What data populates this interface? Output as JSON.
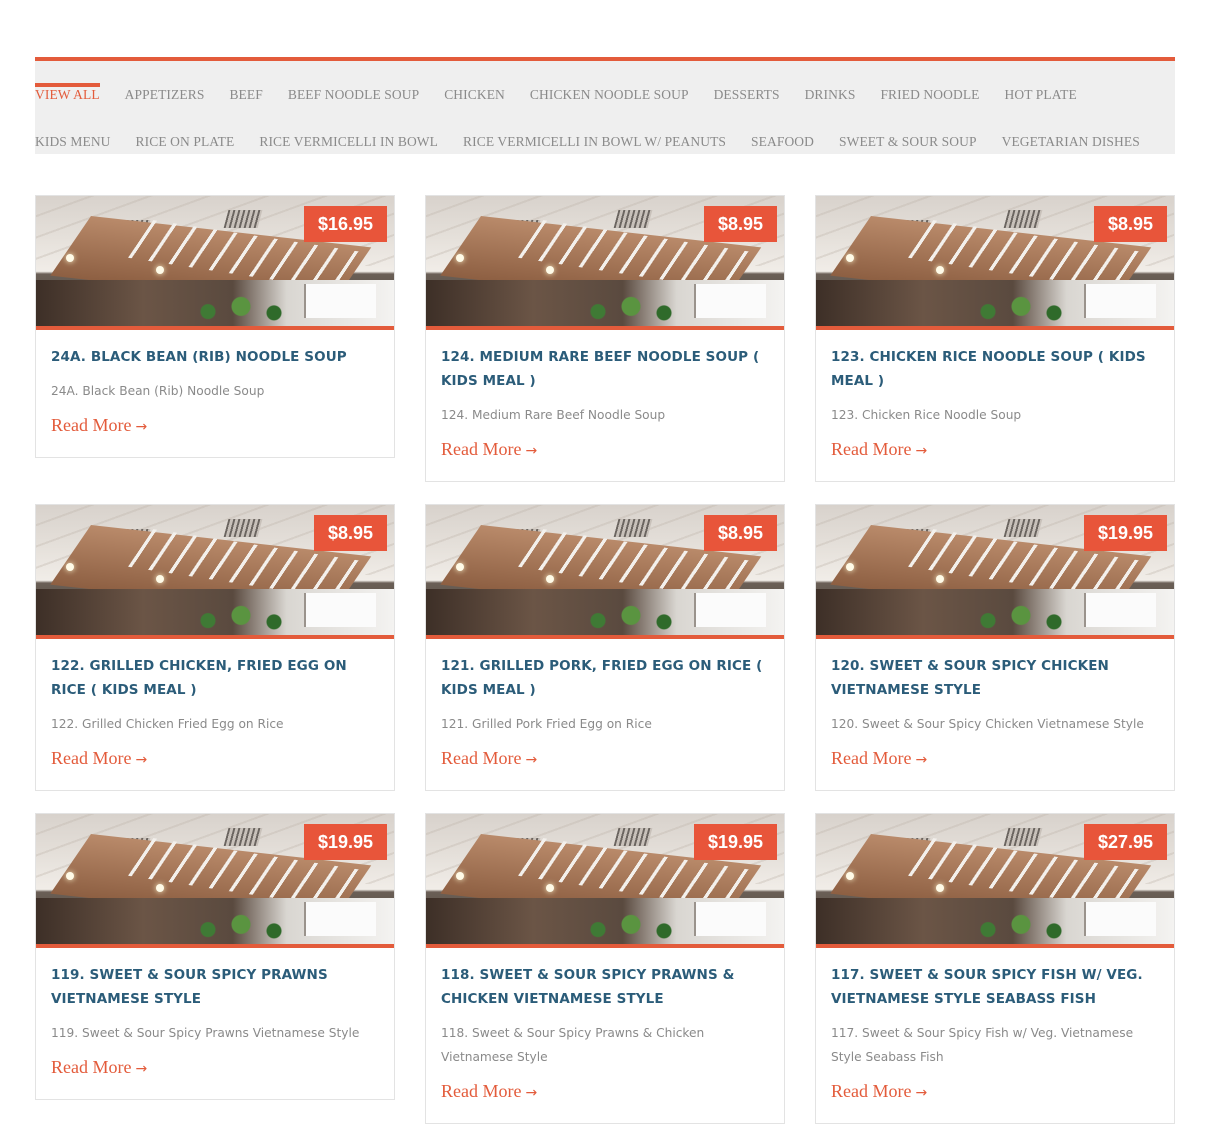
{
  "filters": {
    "row1": [
      "VIEW ALL",
      "APPETIZERS",
      "BEEF",
      "BEEF NOODLE SOUP",
      "CHICKEN",
      "CHICKEN NOODLE SOUP",
      "DESSERTS",
      "DRINKS",
      "FRIED NOODLE",
      "HOT PLATE"
    ],
    "row2": [
      "KIDS MENU",
      "RICE ON PLATE",
      "RICE VERMICELLI IN BOWL",
      "RICE VERMICELLI IN BOWL W/ PEANUTS",
      "SEAFOOD",
      "SWEET & SOUR SOUP",
      "VEGETARIAN DISHES"
    ],
    "active": "VIEW ALL"
  },
  "read_more_label": "Read More",
  "read_more_arrow": "→",
  "colors": {
    "accent": "#e35b3b",
    "title": "#2b5c79",
    "muted": "#8a8a8a",
    "filter_bg": "#efefef"
  },
  "cards": [
    {
      "price": "$16.95",
      "title": "24A. BLACK BEAN (RIB) NOODLE SOUP",
      "desc": "24A. Black Bean (Rib) Noodle Soup"
    },
    {
      "price": "$8.95",
      "title": "124. MEDIUM RARE BEEF NOODLE SOUP ( KIDS MEAL )",
      "desc": "124. Medium Rare Beef Noodle Soup"
    },
    {
      "price": "$8.95",
      "title": "123. CHICKEN RICE NOODLE SOUP ( KIDS MEAL )",
      "desc": "123. Chicken Rice Noodle Soup"
    },
    {
      "price": "$8.95",
      "title": "122. GRILLED CHICKEN, FRIED EGG ON RICE ( KIDS MEAL )",
      "desc": "122. Grilled Chicken Fried Egg on Rice"
    },
    {
      "price": "$8.95",
      "title": "121. GRILLED PORK, FRIED EGG ON RICE ( KIDS MEAL )",
      "desc": "121. Grilled Pork Fried Egg on Rice"
    },
    {
      "price": "$19.95",
      "title": "120. SWEET & SOUR SPICY CHICKEN VIETNAMESE STYLE",
      "desc": "120. Sweet & Sour Spicy Chicken Vietnamese Style"
    },
    {
      "price": "$19.95",
      "title": "119. SWEET & SOUR SPICY PRAWNS VIETNAMESE STYLE",
      "desc": "119. Sweet & Sour Spicy Prawns Vietnamese Style"
    },
    {
      "price": "$19.95",
      "title": "118. SWEET & SOUR SPICY PRAWNS & CHICKEN VIETNAMESE STYLE",
      "desc": "118. Sweet & Sour Spicy Prawns & Chicken Vietnamese Style"
    },
    {
      "price": "$27.95",
      "title": "117. SWEET & SOUR SPICY FISH W/ VEG. VIETNAMESE STYLE SEABASS FISH",
      "desc": "117. Sweet & Sour Spicy Fish w/ Veg. Vietnamese Style Seabass Fish"
    }
  ]
}
